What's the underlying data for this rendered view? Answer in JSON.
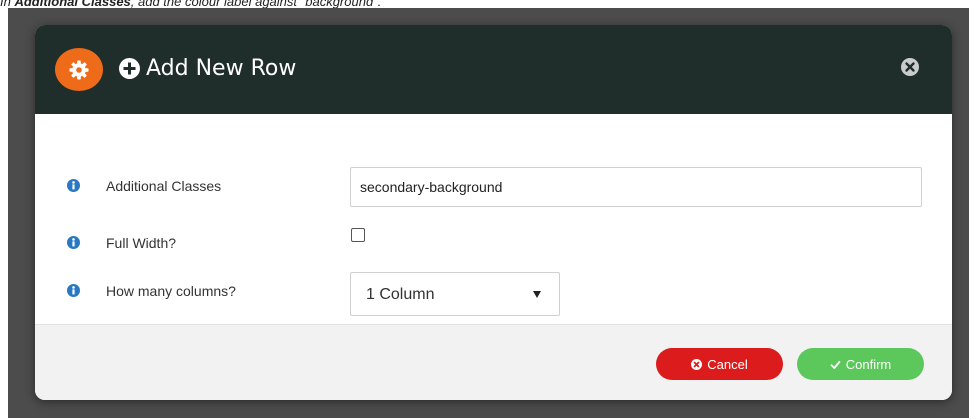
{
  "instruction": {
    "prefix": "In ",
    "bold": "Additional Classes",
    "suffix": ", add the colour label against \"background\"."
  },
  "modal": {
    "title": "Add New Row",
    "header_icon": "gear-icon",
    "title_icon": "plus-circle-icon",
    "close_icon": "close-circle-icon"
  },
  "form": {
    "fields": [
      {
        "label": "Additional Classes",
        "icon": "info-icon",
        "value": "secondary-background"
      },
      {
        "label": "Full Width?",
        "icon": "info-icon",
        "checked": false
      },
      {
        "label": "How many columns?",
        "icon": "info-icon",
        "selected": "1 Column"
      }
    ]
  },
  "footer": {
    "cancel_label": "Cancel",
    "cancel_icon": "times-circle-icon",
    "confirm_label": "Confirm",
    "confirm_icon": "check-icon"
  },
  "colors": {
    "header_bg": "#1f2d2b",
    "gear_badge": "#ee6b1a",
    "info_icon": "#2b78c2",
    "cancel": "#dc1c1c",
    "confirm": "#5cc85c",
    "backdrop": "#4c4c4c"
  }
}
